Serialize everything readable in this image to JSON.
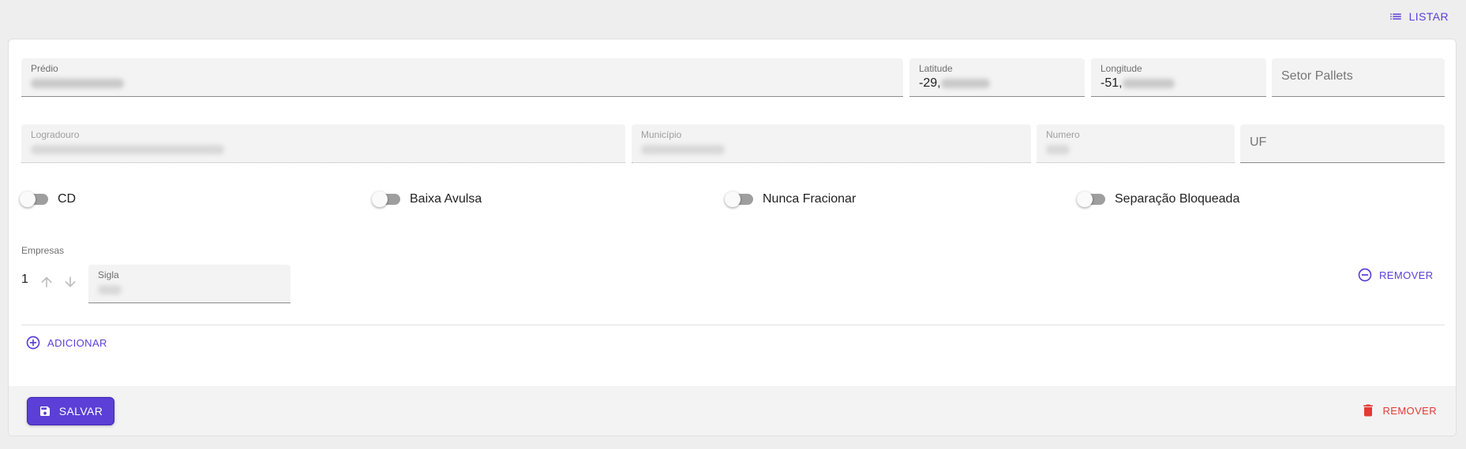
{
  "header": {
    "listar_label": "LISTAR",
    "listar_icon": "list-icon"
  },
  "form": {
    "predio": {
      "label": "Prédio"
    },
    "latitude": {
      "label": "Latitude",
      "value_prefix": "-29,"
    },
    "longitude": {
      "label": "Longitude",
      "value_prefix": "-51,"
    },
    "setor_pallets": {
      "placeholder": "Setor Pallets"
    },
    "logradouro": {
      "label": "Logradouro"
    },
    "municipio": {
      "label": "Município"
    },
    "numero": {
      "label": "Numero"
    },
    "uf": {
      "placeholder": "UF"
    }
  },
  "toggles": [
    {
      "label": "CD",
      "checked": false
    },
    {
      "label": "Baixa Avulsa",
      "checked": false
    },
    {
      "label": "Nunca Fracionar",
      "checked": false
    },
    {
      "label": "Separação Bloqueada",
      "checked": false
    }
  ],
  "empresas": {
    "section_label": "Empresas",
    "rows": [
      {
        "index": "1",
        "sigla_label": "Sigla"
      }
    ],
    "remove_label": "REMOVER",
    "add_label": "ADICIONAR"
  },
  "footer": {
    "save_label": "SALVAR",
    "remove_label": "REMOVER"
  },
  "colors": {
    "primary": "#5b3fd6",
    "danger": "#e53935",
    "background": "#eeeeee"
  }
}
